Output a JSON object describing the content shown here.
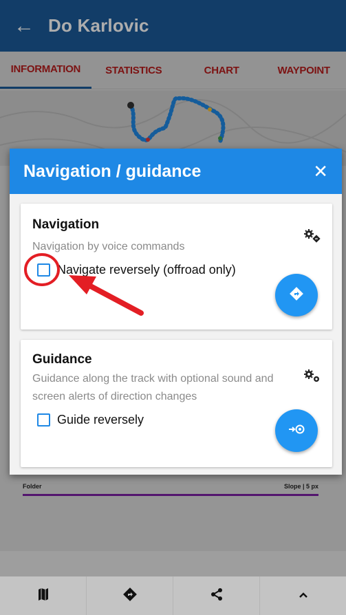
{
  "appbar": {
    "title": "Do Karlovic",
    "back_icon": "arrow-left-icon"
  },
  "tabs": [
    {
      "label": "INFORMATION",
      "active": true
    },
    {
      "label": "STATISTICS",
      "active": false
    },
    {
      "label": "CHART",
      "active": false
    },
    {
      "label": "WAYPOINT",
      "active": false
    }
  ],
  "folder_row": {
    "left": "Folder",
    "right": "Slope | 5 px",
    "line_color": "#7b1fa2"
  },
  "dialog": {
    "title": "Navigation / guidance",
    "close_icon": "close-icon",
    "navigation": {
      "title": "Navigation",
      "description": "Navigation by voice commands",
      "checkbox_label": "Navigate reversely (offroad only)",
      "checked": false,
      "settings_icon": "gears-icon",
      "action_icon": "turn-diamond-icon"
    },
    "guidance": {
      "title": "Guidance",
      "description": "Guidance along the track with optional sound and screen alerts of direction changes",
      "checkbox_label": "Guide reversely",
      "checked": false,
      "settings_icon": "gears-icon",
      "action_icon": "arrow-to-target-icon"
    }
  },
  "bottom_nav": [
    {
      "icon": "map-icon"
    },
    {
      "icon": "navigate-diamond-icon"
    },
    {
      "icon": "share-icon"
    },
    {
      "icon": "chevron-up-icon"
    }
  ],
  "colors": {
    "appbar": "#1b5a9a",
    "dialog_header": "#1e88e5",
    "fab": "#2196f3",
    "tab_text": "#b71c1c",
    "annotation": "#e31e24"
  }
}
